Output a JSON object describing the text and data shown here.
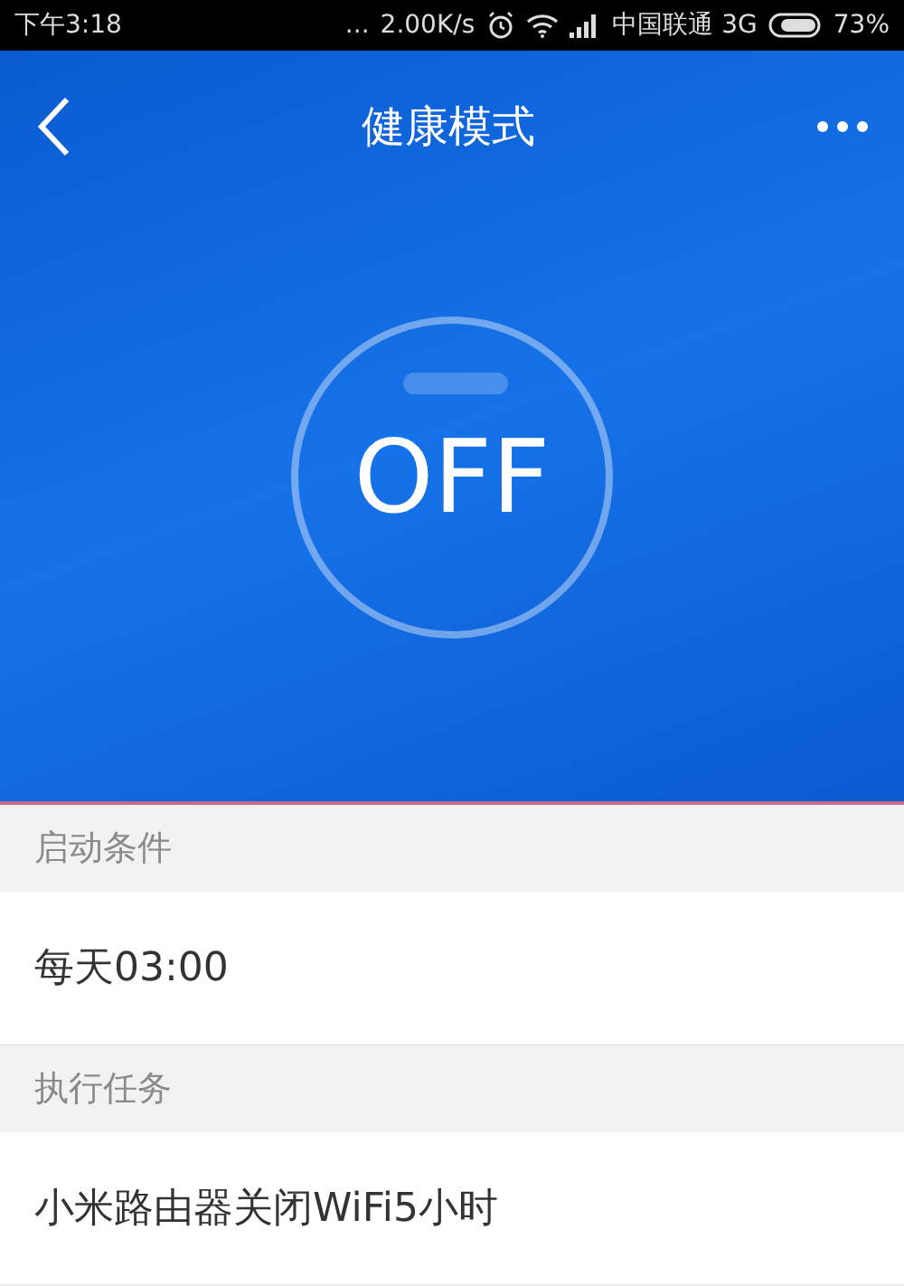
{
  "status_bar": {
    "time": "下午3:18",
    "dots": "...",
    "speed": "2.00K/s",
    "carrier": "中国联通 3G",
    "battery": "73%"
  },
  "header": {
    "title": "健康模式"
  },
  "power_switch": {
    "label": "OFF",
    "on": false
  },
  "sections": [
    {
      "heading": "启动条件",
      "value": "每天03:00"
    },
    {
      "heading": "执行任务",
      "value": "小米路由器关闭WiFi5小时"
    }
  ]
}
